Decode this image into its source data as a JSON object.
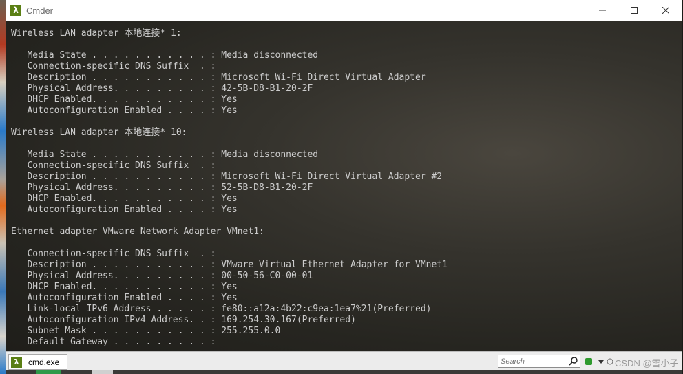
{
  "window": {
    "title": "Cmder",
    "app_icon": "λ"
  },
  "console": {
    "lines": [
      "Wireless LAN adapter 本地连接* 1:",
      "",
      "   Media State . . . . . . . . . . . : Media disconnected",
      "   Connection-specific DNS Suffix  . :",
      "   Description . . . . . . . . . . . : Microsoft Wi-Fi Direct Virtual Adapter",
      "   Physical Address. . . . . . . . . : 42-5B-D8-B1-20-2F",
      "   DHCP Enabled. . . . . . . . . . . : Yes",
      "   Autoconfiguration Enabled . . . . : Yes",
      "",
      "Wireless LAN adapter 本地连接* 10:",
      "",
      "   Media State . . . . . . . . . . . : Media disconnected",
      "   Connection-specific DNS Suffix  . :",
      "   Description . . . . . . . . . . . : Microsoft Wi-Fi Direct Virtual Adapter #2",
      "   Physical Address. . . . . . . . . : 52-5B-D8-B1-20-2F",
      "   DHCP Enabled. . . . . . . . . . . : Yes",
      "   Autoconfiguration Enabled . . . . : Yes",
      "",
      "Ethernet adapter VMware Network Adapter VMnet1:",
      "",
      "   Connection-specific DNS Suffix  . :",
      "   Description . . . . . . . . . . . : VMware Virtual Ethernet Adapter for VMnet1",
      "   Physical Address. . . . . . . . . : 00-50-56-C0-00-01",
      "   DHCP Enabled. . . . . . . . . . . : Yes",
      "   Autoconfiguration Enabled . . . . : Yes",
      "   Link-local IPv6 Address . . . . . : fe80::a12a:4b22:c9ea:1ea7%21(Preferred)",
      "   Autoconfiguration IPv4 Address. . : 169.254.30.167(Preferred)",
      "   Subnet Mask . . . . . . . . . . . : 255.255.0.0",
      "   Default Gateway . . . . . . . . . :"
    ]
  },
  "tabbar": {
    "tab_label": "cmd.exe",
    "tab_icon": "λ",
    "search_placeholder": "Search",
    "watermark": "CSDN @雪小子"
  },
  "colors": {
    "console_text": "#cccccc",
    "icon_green": "#5a7f14"
  }
}
